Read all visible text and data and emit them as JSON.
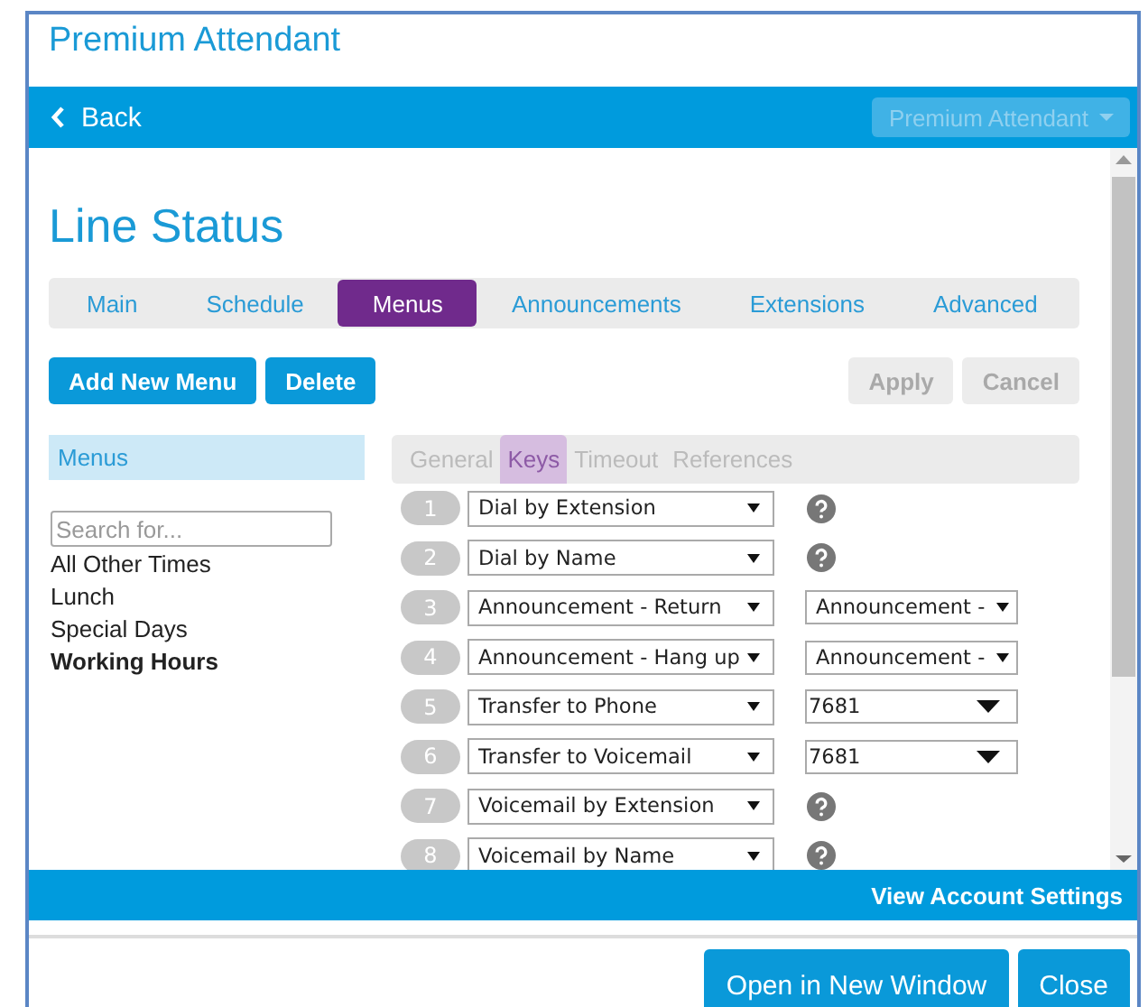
{
  "window": {
    "title": "Premium Attendant"
  },
  "nav_bar": {
    "back": "Back",
    "dropdown": {
      "label": "Premium Attendant",
      "disabled": true
    }
  },
  "page_title": "Line Status",
  "tabs": [
    {
      "label": "Main",
      "selected": false
    },
    {
      "label": "Schedule",
      "selected": false
    },
    {
      "label": "Menus",
      "selected": true
    },
    {
      "label": "Announcements",
      "selected": false
    },
    {
      "label": "Extensions",
      "selected": false
    },
    {
      "label": "Advanced",
      "selected": false
    }
  ],
  "actions": [
    {
      "label": "Add New Menu",
      "disabled": false
    },
    {
      "label": "Delete",
      "disabled": false
    },
    {
      "label": "Apply",
      "disabled": true
    },
    {
      "label": "Cancel",
      "disabled": true
    }
  ],
  "menus_panel": {
    "heading": "Menus",
    "search": {
      "placeholder": "Search for..."
    },
    "items": [
      {
        "label": "All Other Times",
        "selected": false
      },
      {
        "label": "Lunch",
        "selected": false
      },
      {
        "label": "Special Days",
        "selected": false
      },
      {
        "label": "Working Hours",
        "selected": true
      }
    ]
  },
  "sub_tabs": [
    {
      "label": "General",
      "selected": false
    },
    {
      "label": "Keys",
      "selected": true
    },
    {
      "label": "Timeout",
      "selected": false
    },
    {
      "label": "References",
      "selected": false
    }
  ],
  "keys": [
    {
      "key": "1",
      "action": "Dial by Extension",
      "kind": "help"
    },
    {
      "key": "2",
      "action": "Dial by Name",
      "kind": "help"
    },
    {
      "key": "3",
      "action": "Announcement - Return",
      "kind": "select",
      "option": "Announcement -"
    },
    {
      "key": "4",
      "action": "Announcement - Hang up",
      "kind": "select",
      "option": "Announcement -"
    },
    {
      "key": "5",
      "action": "Transfer to Phone",
      "kind": "combo",
      "option": "7681"
    },
    {
      "key": "6",
      "action": "Transfer to Voicemail",
      "kind": "combo",
      "option": "7681"
    },
    {
      "key": "7",
      "action": "Voicemail by Extension",
      "kind": "help"
    },
    {
      "key": "8",
      "action": "Voicemail by Name",
      "kind": "help"
    }
  ],
  "footer_bar": {
    "link": "View Account Settings"
  },
  "bottom_buttons": [
    "Open in New Window",
    "Close"
  ]
}
